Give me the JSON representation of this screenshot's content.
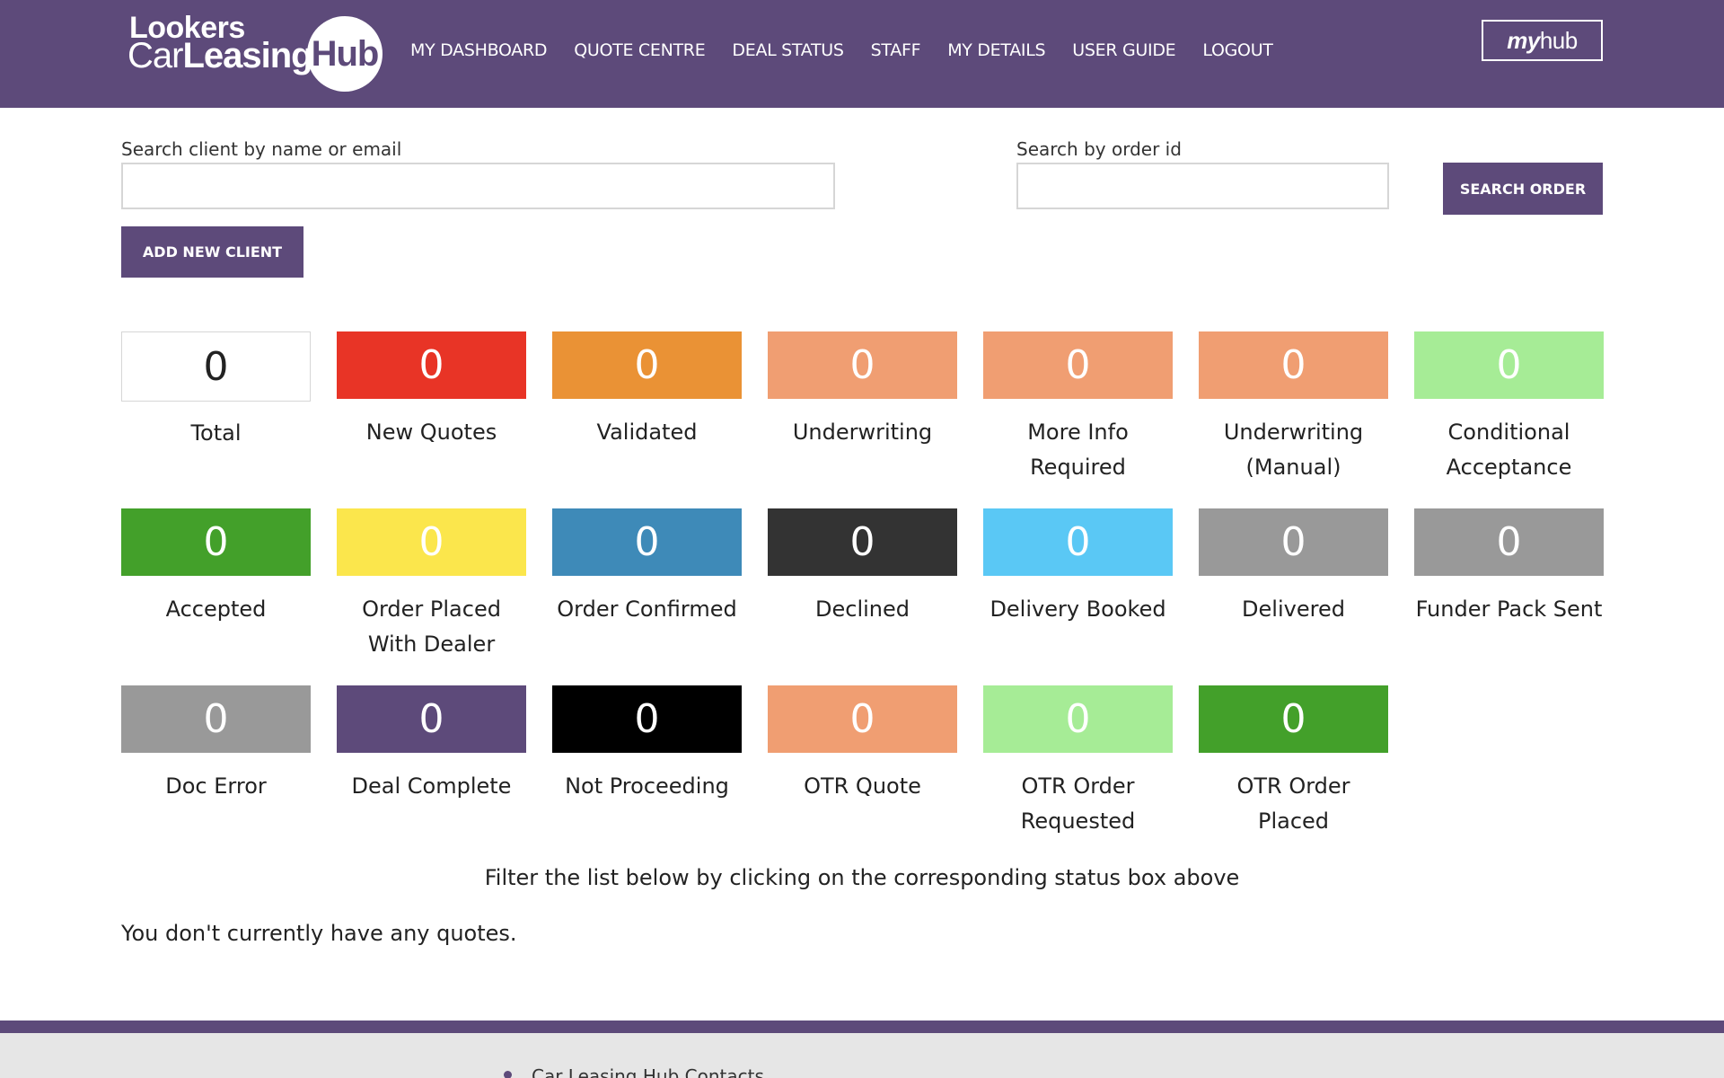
{
  "header": {
    "logo": {
      "line1": "Lookers",
      "line2_light": "Car",
      "line2_bold": "Leasing",
      "circle": "Hub"
    },
    "nav": [
      "MY DASHBOARD",
      "QUOTE CENTRE",
      "DEAL STATUS",
      "STAFF",
      "MY DETAILS",
      "USER GUIDE",
      "LOGOUT"
    ],
    "myhub": {
      "bold": "my",
      "light": "hub"
    }
  },
  "search": {
    "client_label": "Search client by name or email",
    "client_value": "",
    "order_label": "Search by order id",
    "order_value": "",
    "search_order_button": "SEARCH ORDER",
    "add_client_button": "ADD NEW CLIENT"
  },
  "statuses": [
    {
      "count": "0",
      "label": "Total",
      "color": "#ffffff"
    },
    {
      "count": "0",
      "label": "New Quotes",
      "color": "#e83426"
    },
    {
      "count": "0",
      "label": "Validated",
      "color": "#ea9235"
    },
    {
      "count": "0",
      "label": "Underwriting",
      "color": "#f09e72"
    },
    {
      "count": "0",
      "label": "More Info Required",
      "color": "#f09e72"
    },
    {
      "count": "0",
      "label": "Underwriting (Manual)",
      "color": "#f09e72"
    },
    {
      "count": "0",
      "label": "Conditional Acceptance",
      "color": "#a6ec96"
    },
    {
      "count": "0",
      "label": "Accepted",
      "color": "#43a02a"
    },
    {
      "count": "0",
      "label": "Order Placed With Dealer",
      "color": "#fbe64c"
    },
    {
      "count": "0",
      "label": "Order Confirmed",
      "color": "#3e8ab8"
    },
    {
      "count": "0",
      "label": "Declined",
      "color": "#333333"
    },
    {
      "count": "0",
      "label": "Delivery Booked",
      "color": "#5ac8f5"
    },
    {
      "count": "0",
      "label": "Delivered",
      "color": "#999999"
    },
    {
      "count": "0",
      "label": "Funder Pack Sent",
      "color": "#999999"
    },
    {
      "count": "0",
      "label": "Doc Error",
      "color": "#999999"
    },
    {
      "count": "0",
      "label": "Deal Complete",
      "color": "#5d4a7a"
    },
    {
      "count": "0",
      "label": "Not Proceeding",
      "color": "#000000"
    },
    {
      "count": "0",
      "label": "OTR Quote",
      "color": "#f09e72"
    },
    {
      "count": "0",
      "label": "OTR Order Requested",
      "color": "#a6ec96"
    },
    {
      "count": "0",
      "label": "OTR Order Placed",
      "color": "#43a02a"
    }
  ],
  "filter_note": "Filter the list below by clicking on the corresponding status box above",
  "empty_message": "You don't currently have any quotes.",
  "footer": {
    "link": "Car Leasing Hub Contacts"
  }
}
